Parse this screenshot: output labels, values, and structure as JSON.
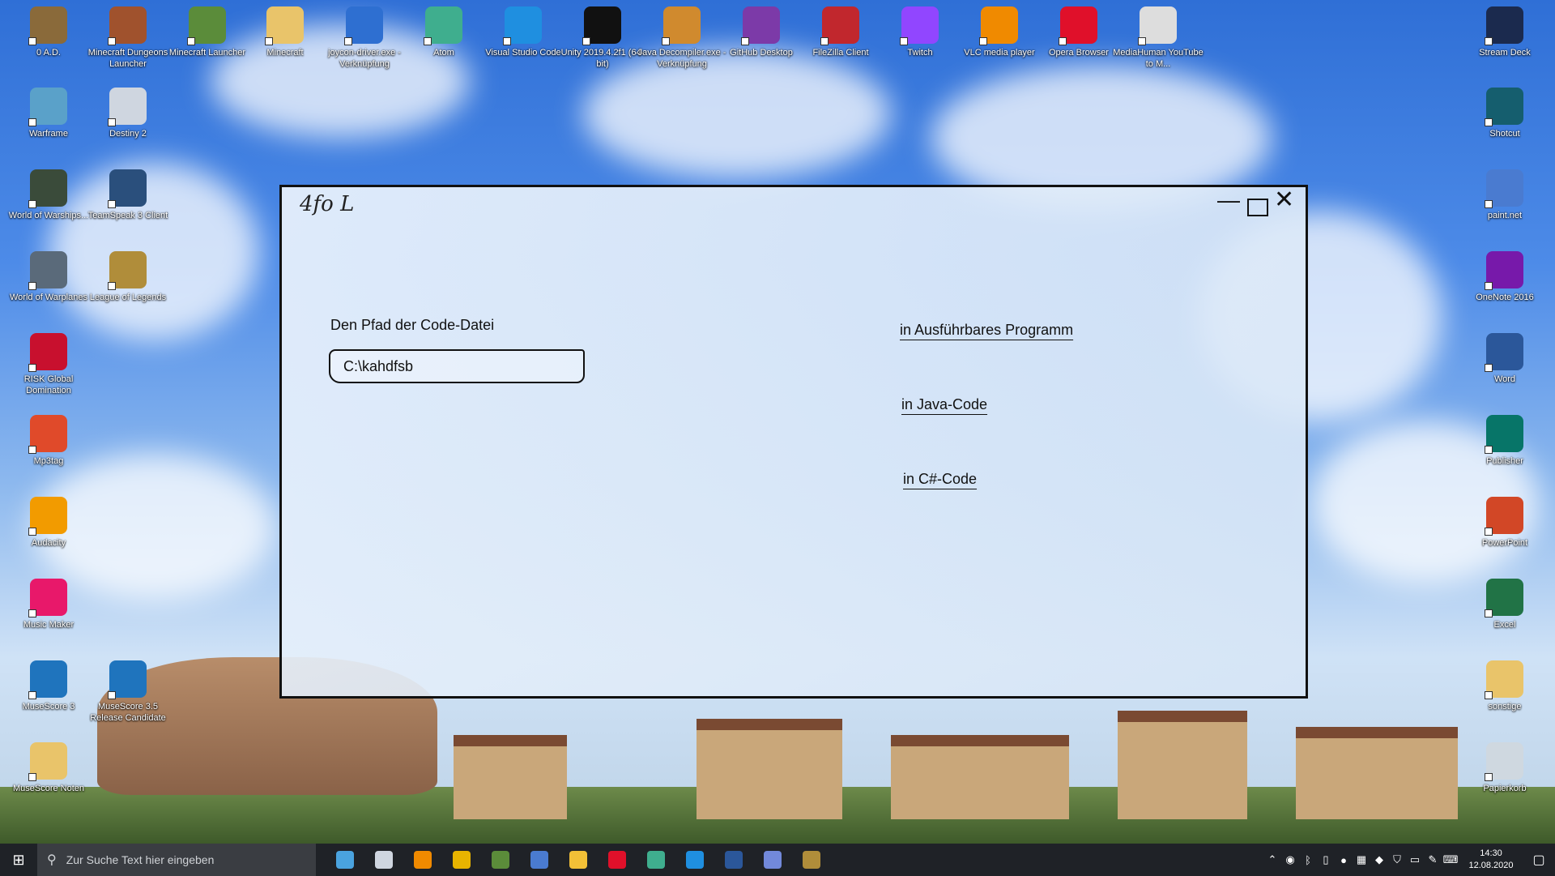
{
  "desktop": {
    "left_icons": [
      {
        "label": "0 A.D.",
        "icon": "0ad-icon",
        "color": "#8a6a3a"
      },
      {
        "label": "Minecraft Dungeons Launcher",
        "icon": "minecraft-dungeons-icon",
        "color": "#a0522d"
      },
      {
        "label": "Minecraft Launcher",
        "icon": "minecraft-launcher-icon",
        "color": "#5b8c3a"
      },
      {
        "label": "Minecraft",
        "icon": "folder-icon",
        "color": "#e9c46a"
      },
      {
        "label": "joycon-driver.exe - Verknüpfung",
        "icon": "app-window-icon",
        "color": "#2e6fd1"
      },
      {
        "label": "Atom",
        "icon": "atom-icon",
        "color": "#3fae8e"
      },
      {
        "label": "Visual Studio Code",
        "icon": "vscode-icon",
        "color": "#1f8fe0"
      },
      {
        "label": "Unity 2019.4.2f1 (64-bit)",
        "icon": "unity-icon",
        "color": "#111111"
      },
      {
        "label": "Java Decompiler.exe - Verknüpfung",
        "icon": "java-cup-icon",
        "color": "#d08a2e"
      },
      {
        "label": "GitHub Desktop",
        "icon": "github-icon",
        "color": "#7c3aa8"
      },
      {
        "label": "FileZilla Client",
        "icon": "filezilla-icon",
        "color": "#c1272d"
      },
      {
        "label": "Twitch",
        "icon": "twitch-icon",
        "color": "#9146ff"
      },
      {
        "label": "VLC media player",
        "icon": "vlc-icon",
        "color": "#f08a00"
      },
      {
        "label": "Opera Browser",
        "icon": "opera-icon",
        "color": "#e0102a"
      },
      {
        "label": "MediaHuman YouTube to M...",
        "icon": "mediahuman-icon",
        "color": "#dddddd"
      },
      {
        "label": "Stream Deck",
        "icon": "stream-deck-icon",
        "color": "#1b2a4e"
      },
      {
        "label": "Warframe",
        "icon": "warframe-icon",
        "color": "#5aa1c9"
      },
      {
        "label": "Destiny 2",
        "icon": "destiny-icon",
        "color": "#cfd6e0"
      },
      {
        "label": "Shotcut",
        "icon": "shotcut-icon",
        "color": "#155e6e"
      },
      {
        "label": "World of Warships...",
        "icon": "warships-icon",
        "color": "#3a4b3a"
      },
      {
        "label": "TeamSpeak 3 Client",
        "icon": "teamspeak-icon",
        "color": "#2a4f7c"
      },
      {
        "label": "paint.net",
        "icon": "paintnet-icon",
        "color": "#4a7bd0"
      },
      {
        "label": "World of Warplanes",
        "icon": "warplanes-icon",
        "color": "#5a6a7a"
      },
      {
        "label": "League of Legends",
        "icon": "league-icon",
        "color": "#b08d3a"
      },
      {
        "label": "OneNote 2016",
        "icon": "onenote-icon",
        "color": "#7719aa"
      },
      {
        "label": "RISK Global Domination",
        "icon": "risk-icon",
        "color": "#c8102e"
      },
      {
        "label": "Word",
        "icon": "word-icon",
        "color": "#2b579a"
      },
      {
        "label": "Mp3tag",
        "icon": "mp3tag-icon",
        "color": "#e04a2a"
      },
      {
        "label": "Publisher",
        "icon": "publisher-icon",
        "color": "#077568"
      },
      {
        "label": "Audacity",
        "icon": "audacity-icon",
        "color": "#f29b00"
      },
      {
        "label": "PowerPoint",
        "icon": "powerpoint-icon",
        "color": "#d24726"
      },
      {
        "label": "Music Maker",
        "icon": "music-maker-icon",
        "color": "#e8186a"
      },
      {
        "label": "Excel",
        "icon": "excel-icon",
        "color": "#217346"
      },
      {
        "label": "MuseScore 3",
        "icon": "musescore-icon",
        "color": "#1f74bd"
      },
      {
        "label": "MuseScore 3.5 Release Candidate",
        "icon": "musescore-rc-icon",
        "color": "#1f74bd"
      },
      {
        "label": "sonstige",
        "icon": "folder-icon",
        "color": "#e9c46a"
      },
      {
        "label": "MuseScore Noten",
        "icon": "folder-icon",
        "color": "#e9c46a"
      },
      {
        "label": "Papierkorb",
        "icon": "recycle-bin-icon",
        "color": "#cfd8e0"
      }
    ]
  },
  "window": {
    "title": "4fo L",
    "min_symbol": "—",
    "close_symbol": "✕",
    "path_label": "Den Pfad der Code-Datei",
    "path_value": "C:\\kahdfsb",
    "options": [
      {
        "label": "in Ausführbares Programm"
      },
      {
        "label": "in Java-Code"
      },
      {
        "label": "in C#-Code"
      }
    ]
  },
  "taskbar": {
    "start_symbol": "⊞",
    "search_placeholder": "Zur Suche Text hier eingeben",
    "apps": [
      {
        "icon": "task-view-icon",
        "color": "#4aa3df"
      },
      {
        "icon": "destiny-icon",
        "color": "#cfd6e0"
      },
      {
        "icon": "vlc-icon",
        "color": "#f08a00"
      },
      {
        "icon": "teamspeak-icon",
        "color": "#e8b400"
      },
      {
        "icon": "minecraft-icon",
        "color": "#5b8c3a"
      },
      {
        "icon": "paintnet-icon",
        "color": "#4a7bd0"
      },
      {
        "icon": "file-explorer-icon",
        "color": "#f2c037"
      },
      {
        "icon": "opera-icon",
        "color": "#e0102a"
      },
      {
        "icon": "atom-icon",
        "color": "#3fae8e"
      },
      {
        "icon": "vscode-icon",
        "color": "#1f8fe0"
      },
      {
        "icon": "word-icon",
        "color": "#2b579a"
      },
      {
        "icon": "discord-icon",
        "color": "#7289da"
      },
      {
        "icon": "league-icon",
        "color": "#b08d3a"
      }
    ],
    "clock_time": "14:30",
    "clock_date": "12.08.2020"
  }
}
